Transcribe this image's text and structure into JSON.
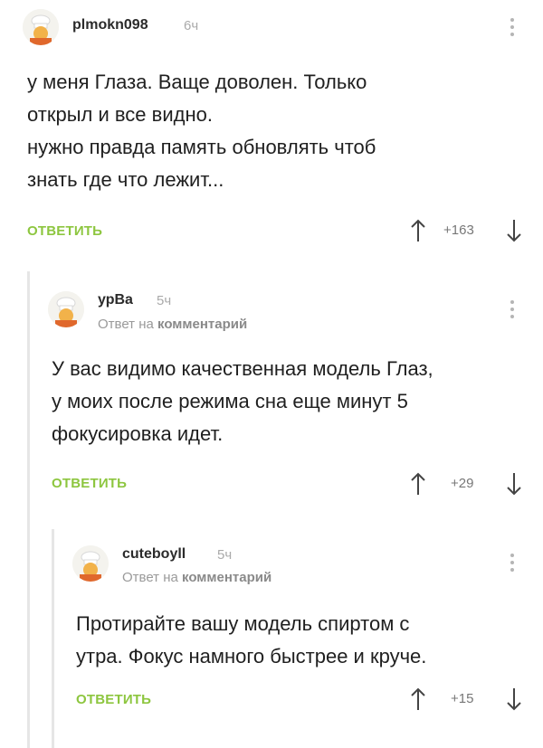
{
  "comments": [
    {
      "author": "plmokn098",
      "time": "6ч",
      "reply_to_prefix": "",
      "reply_to_target": "",
      "lines": [
        "у меня Глаза. Ваще доволен. Только",
        "открыл и все видно.",
        "нужно правда память обновлять чтоб",
        "знать где что лежит..."
      ],
      "reply_label": "ОТВЕТИТЬ",
      "score": "+163"
    },
    {
      "author": "урВа",
      "time": "5ч",
      "reply_to_prefix": "Ответ на",
      "reply_to_target": "комментарий",
      "lines": [
        "У вас видимо качественная модель Глаз,",
        "у моих после режима сна еще минут 5",
        "фокусировка идет."
      ],
      "reply_label": "ОТВЕТИТЬ",
      "score": "+29"
    },
    {
      "author": "cuteboyll",
      "time": "5ч",
      "reply_to_prefix": "Ответ на",
      "reply_to_target": "комментарий",
      "lines": [
        "Протирайте вашу модель спиртом с",
        "утра. Фокус намного быстрее и круче."
      ],
      "reply_label": "ОТВЕТИТЬ",
      "score": "+15"
    }
  ],
  "icons": {
    "avatar": "default-avatar-chef-icon",
    "more": "more-vertical-icon",
    "upvote": "arrow-up-icon",
    "downvote": "arrow-down-icon"
  },
  "colors": {
    "reply": "#8dc63f",
    "thread_line": "#e6e6e6",
    "muted": "#aaaaaa"
  }
}
